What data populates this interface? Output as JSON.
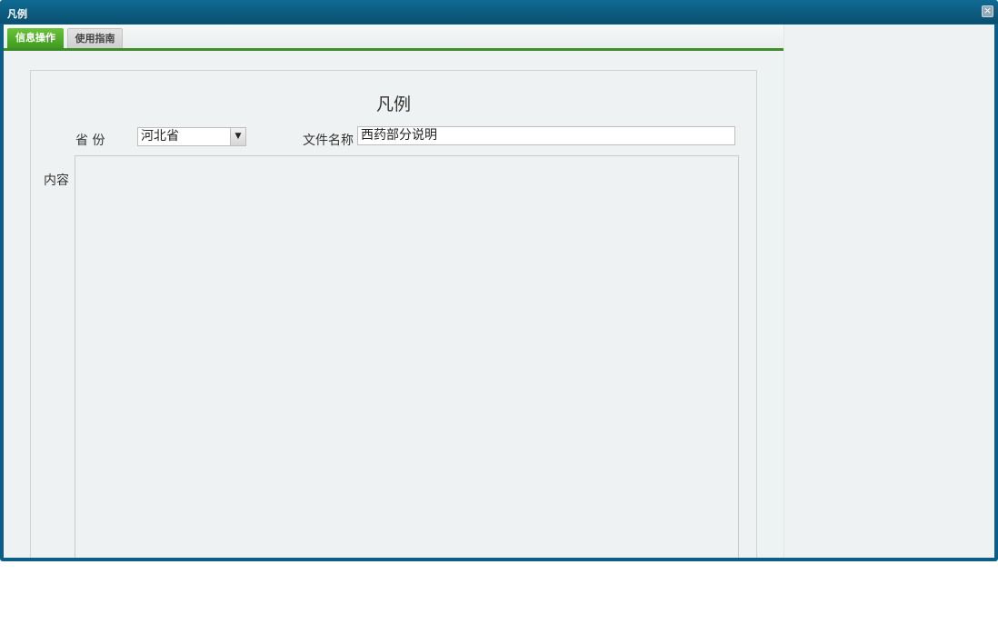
{
  "window": {
    "title": "凡例",
    "close_symbol": "×"
  },
  "tabs": [
    {
      "label": "信息操作",
      "active": true
    },
    {
      "label": "使用指南",
      "active": false
    }
  ],
  "form": {
    "title": "凡例",
    "province_label": "省 份",
    "province_value": "河北省",
    "filename_label": "文件名称",
    "filename_value": "西药部分说明",
    "content_label": "内容",
    "content_value": ""
  },
  "colors": {
    "titlebar": "#0a4f70",
    "tab_active": "#3f9a1f",
    "tab_underline": "#3f8c2a",
    "background": "#eef2f2"
  },
  "icons": {
    "close": "close-icon",
    "dropdown": "chevron-down-icon"
  }
}
